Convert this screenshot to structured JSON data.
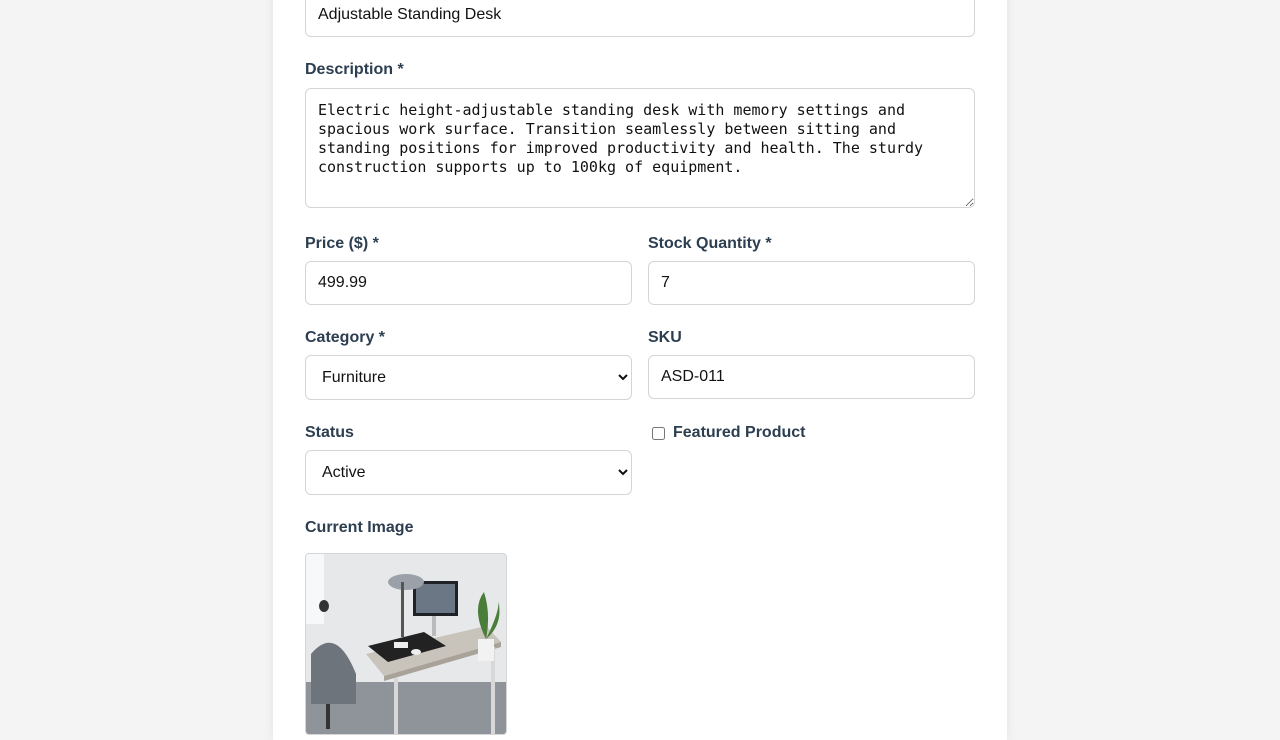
{
  "form": {
    "name_value": "Adjustable Standing Desk",
    "description_label": "Description *",
    "description_value": "Electric height-adjustable standing desk with memory settings and spacious work surface. Transition seamlessly between sitting and standing positions for improved productivity and health. The sturdy construction supports up to 100kg of equipment.",
    "price_label": "Price ($) *",
    "price_value": "499.99",
    "stock_label": "Stock Quantity *",
    "stock_value": "7",
    "category_label": "Category *",
    "category_value": "Furniture",
    "sku_label": "SKU",
    "sku_value": "ASD-011",
    "status_label": "Status",
    "status_value": "Active",
    "featured_label": "Featured Product",
    "featured_checked": false,
    "current_image_label": "Current Image"
  }
}
